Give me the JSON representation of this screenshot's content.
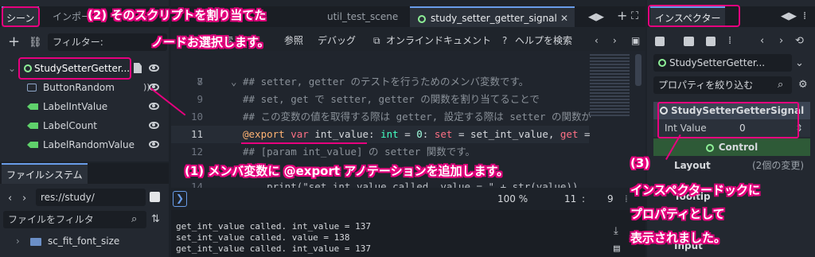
{
  "scene": {
    "tab_scene": "シーン",
    "tab_import": "インポー",
    "filter_placeholder": "フィルター:",
    "root_node": "StudySetterGetter...",
    "children": [
      "ButtonRandom",
      "LabelIntValue",
      "LabelCount",
      "LabelRandomValue"
    ]
  },
  "filesystem": {
    "title": "ファイルシステム",
    "path": "res://study/",
    "filter_placeholder": "ファイルをフィルタ",
    "folder": "sc_fit_font_size"
  },
  "editor": {
    "tabs": [
      "util_test_scene",
      "study_setter_getter_signal"
    ],
    "toolbar": [
      "索",
      "参照",
      "デバッグ",
      "オンラインドキュメント",
      "ヘルプを検索"
    ],
    "lines": [
      {
        "n": "7",
        "text": ""
      },
      {
        "n": "8",
        "text": "## setter, getter のテストを行うためのメンバ変数です。"
      },
      {
        "n": "9",
        "text": "## set, get で setter, getter の関数を割り当てることで"
      },
      {
        "n": "10",
        "text": "## この変数の値を取得する際は getter, 設定する際は setter の関数が"
      },
      {
        "n": "11",
        "annotation": "@export",
        "kw": "var",
        "name": " int_value: ",
        "type": "int",
        "rest1": " = ",
        "num": "0",
        "rest2": ": ",
        "set": "set",
        "rest3": " = set_int_value, ",
        "get": "get",
        "rest4": " ="
      },
      {
        "n": "12",
        "text": "## [param int_value] の setter 関数です。"
      },
      {
        "n": "13",
        "text": ""
      },
      {
        "n": "14",
        "text": "    print(\"set int value called. value = \" + str(value))"
      }
    ],
    "status": {
      "zoom": "100 %",
      "line": "11",
      "col": "9"
    },
    "output": [
      "get_int_value called. int_value = 137",
      "set_int_value called. value = 138",
      "get_int_value called. int_value = 137"
    ]
  },
  "inspector": {
    "title": "インスペクター",
    "node": "StudySetterGetter...",
    "filter_placeholder": "プロパティを絞り込む",
    "section": "StudySetterGetterSignal",
    "prop_label": "Int Value",
    "prop_value": "0",
    "subsection": "Control",
    "layout": "Layout",
    "layout_note": "(2個の変更)",
    "tooltip": "Tooltip",
    "input": "Input"
  },
  "notes": {
    "n1": "(1) メンバ変数に @export アノテーションを追加します。",
    "n2a": "(2) そのスクリプトを割り当てた",
    "n2b": "ノードお選択します。",
    "n3a": "(3)",
    "n3b": "インスペクタードックに",
    "n3c": "プロパティとして",
    "n3d": "表示されました。"
  },
  "colors": {
    "accent": "#699ce8",
    "annotation": "#e6007e",
    "label_green": "#5fd16b"
  }
}
